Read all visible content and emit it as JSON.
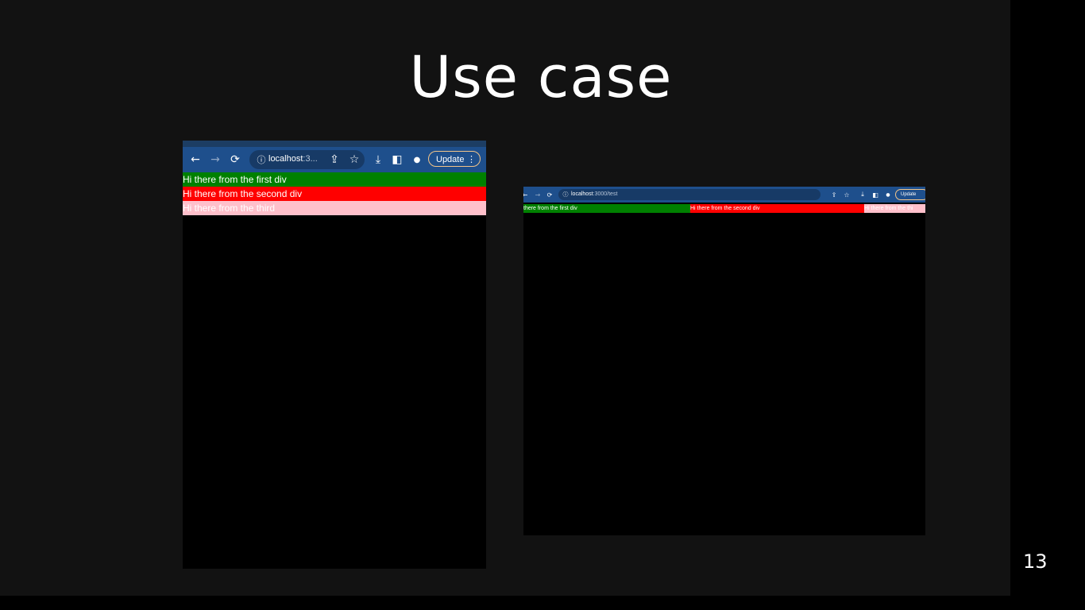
{
  "slide": {
    "title": "Use case",
    "page_number": "13"
  },
  "left_browser": {
    "url_host": "localhost",
    "url_rest": ":3...",
    "update_label": "Update",
    "divs": [
      {
        "text": "Hi there from the first div",
        "bg": "#008000",
        "color": "#ffffff"
      },
      {
        "text": "Hi there from the second div",
        "bg": "#ff0000",
        "color": "#ffffff"
      },
      {
        "text": "Hi there from the third",
        "bg": "#ffc0cb",
        "color": "#ffffff"
      }
    ]
  },
  "right_browser": {
    "url_host": "localhost",
    "url_rest": ":3000/test",
    "update_label": "Update",
    "divs": [
      {
        "text": "there from the first div",
        "bg": "#008000",
        "color": "#ffffff"
      },
      {
        "text": "Hi there from the second div",
        "bg": "#ff0000",
        "color": "#ffffff"
      },
      {
        "text": "Hi there from the thi",
        "bg": "#ffc0cb",
        "color": "#ffffff"
      }
    ]
  },
  "icons": {
    "back": "←",
    "forward": "→",
    "reload": "⟳",
    "info": "ⓘ",
    "share": "⇪",
    "star": "☆",
    "download": "⤓",
    "sidepanel": "◧",
    "profile": "●",
    "menu": "⋮"
  },
  "colors": {
    "toolbar": "#1e4f8c",
    "omnibox": "#173a66",
    "slide_bg": "#121212"
  }
}
